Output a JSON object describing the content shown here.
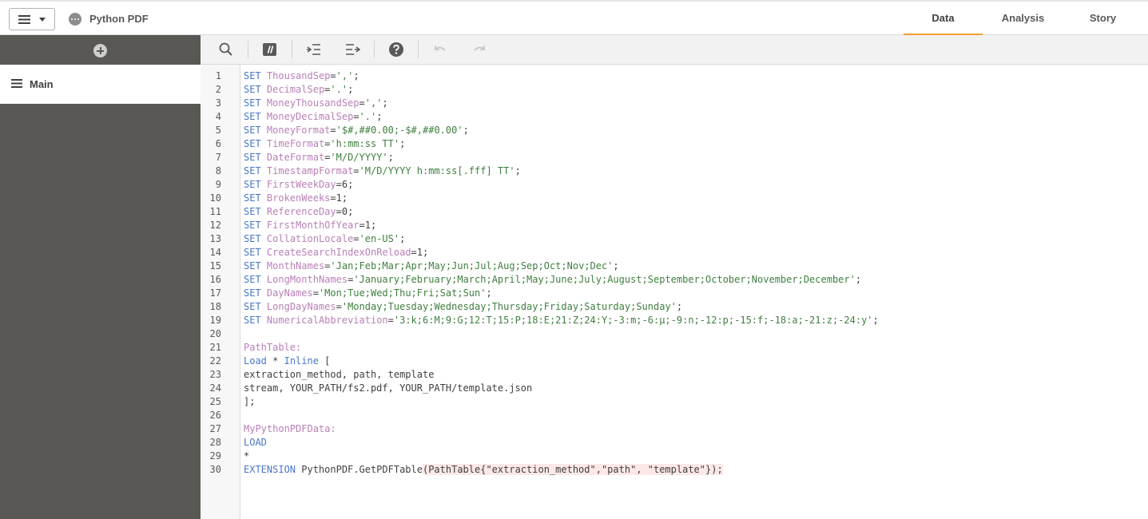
{
  "header": {
    "app_title": "Python PDF",
    "tabs": [
      {
        "label": "Data",
        "active": true
      },
      {
        "label": "Analysis",
        "active": false
      },
      {
        "label": "Story",
        "active": false
      }
    ],
    "accent_color": "#f0a030"
  },
  "sidebar": {
    "add_icon": "plus-circle-icon",
    "sections": [
      {
        "label": "Main",
        "active": true
      }
    ]
  },
  "toolbar": {
    "icons": [
      "search-icon",
      "comment-icon",
      "indent-icon",
      "outdent-icon",
      "help-icon",
      "undo-icon",
      "redo-icon"
    ]
  },
  "editor": {
    "lines": [
      {
        "n": "1",
        "tokens": [
          [
            "k",
            "SET"
          ],
          [
            "p",
            " "
          ],
          [
            "v",
            "ThousandSep"
          ],
          [
            "p",
            "="
          ],
          [
            "s",
            "','"
          ],
          [
            "p",
            ";"
          ]
        ]
      },
      {
        "n": "2",
        "tokens": [
          [
            "k",
            "SET"
          ],
          [
            "p",
            " "
          ],
          [
            "v",
            "DecimalSep"
          ],
          [
            "p",
            "="
          ],
          [
            "s",
            "'.'"
          ],
          [
            "p",
            ";"
          ]
        ]
      },
      {
        "n": "3",
        "tokens": [
          [
            "k",
            "SET"
          ],
          [
            "p",
            " "
          ],
          [
            "v",
            "MoneyThousandSep"
          ],
          [
            "p",
            "="
          ],
          [
            "s",
            "','"
          ],
          [
            "p",
            ";"
          ]
        ]
      },
      {
        "n": "4",
        "tokens": [
          [
            "k",
            "SET"
          ],
          [
            "p",
            " "
          ],
          [
            "v",
            "MoneyDecimalSep"
          ],
          [
            "p",
            "="
          ],
          [
            "s",
            "'.'"
          ],
          [
            "p",
            ";"
          ]
        ]
      },
      {
        "n": "5",
        "tokens": [
          [
            "k",
            "SET"
          ],
          [
            "p",
            " "
          ],
          [
            "v",
            "MoneyFormat"
          ],
          [
            "p",
            "="
          ],
          [
            "s",
            "'$#,##0.00;-$#,##0.00'"
          ],
          [
            "p",
            ";"
          ]
        ]
      },
      {
        "n": "6",
        "tokens": [
          [
            "k",
            "SET"
          ],
          [
            "p",
            " "
          ],
          [
            "v",
            "TimeFormat"
          ],
          [
            "p",
            "="
          ],
          [
            "s",
            "'h:mm:ss TT'"
          ],
          [
            "p",
            ";"
          ]
        ]
      },
      {
        "n": "7",
        "tokens": [
          [
            "k",
            "SET"
          ],
          [
            "p",
            " "
          ],
          [
            "v",
            "DateFormat"
          ],
          [
            "p",
            "="
          ],
          [
            "s",
            "'M/D/YYYY'"
          ],
          [
            "p",
            ";"
          ]
        ]
      },
      {
        "n": "8",
        "tokens": [
          [
            "k",
            "SET"
          ],
          [
            "p",
            " "
          ],
          [
            "v",
            "TimestampFormat"
          ],
          [
            "p",
            "="
          ],
          [
            "s",
            "'M/D/YYYY h:mm:ss[.fff] TT'"
          ],
          [
            "p",
            ";"
          ]
        ]
      },
      {
        "n": "9",
        "tokens": [
          [
            "k",
            "SET"
          ],
          [
            "p",
            " "
          ],
          [
            "v",
            "FirstWeekDay"
          ],
          [
            "p",
            "=6;"
          ]
        ]
      },
      {
        "n": "10",
        "tokens": [
          [
            "k",
            "SET"
          ],
          [
            "p",
            " "
          ],
          [
            "v",
            "BrokenWeeks"
          ],
          [
            "p",
            "=1;"
          ]
        ]
      },
      {
        "n": "11",
        "tokens": [
          [
            "k",
            "SET"
          ],
          [
            "p",
            " "
          ],
          [
            "v",
            "ReferenceDay"
          ],
          [
            "p",
            "=0;"
          ]
        ]
      },
      {
        "n": "12",
        "tokens": [
          [
            "k",
            "SET"
          ],
          [
            "p",
            " "
          ],
          [
            "v",
            "FirstMonthOfYear"
          ],
          [
            "p",
            "=1;"
          ]
        ]
      },
      {
        "n": "13",
        "tokens": [
          [
            "k",
            "SET"
          ],
          [
            "p",
            " "
          ],
          [
            "v",
            "CollationLocale"
          ],
          [
            "p",
            "="
          ],
          [
            "s",
            "'en-US'"
          ],
          [
            "p",
            ";"
          ]
        ]
      },
      {
        "n": "14",
        "tokens": [
          [
            "k",
            "SET"
          ],
          [
            "p",
            " "
          ],
          [
            "v",
            "CreateSearchIndexOnReload"
          ],
          [
            "p",
            "=1;"
          ]
        ]
      },
      {
        "n": "15",
        "tokens": [
          [
            "k",
            "SET"
          ],
          [
            "p",
            " "
          ],
          [
            "v",
            "MonthNames"
          ],
          [
            "p",
            "="
          ],
          [
            "s",
            "'Jan;Feb;Mar;Apr;May;Jun;Jul;Aug;Sep;Oct;Nov;Dec'"
          ],
          [
            "p",
            ";"
          ]
        ]
      },
      {
        "n": "16",
        "tokens": [
          [
            "k",
            "SET"
          ],
          [
            "p",
            " "
          ],
          [
            "v",
            "LongMonthNames"
          ],
          [
            "p",
            "="
          ],
          [
            "s",
            "'January;February;March;April;May;June;July;August;September;October;November;December'"
          ],
          [
            "p",
            ";"
          ]
        ]
      },
      {
        "n": "17",
        "tokens": [
          [
            "k",
            "SET"
          ],
          [
            "p",
            " "
          ],
          [
            "v",
            "DayNames"
          ],
          [
            "p",
            "="
          ],
          [
            "s",
            "'Mon;Tue;Wed;Thu;Fri;Sat;Sun'"
          ],
          [
            "p",
            ";"
          ]
        ]
      },
      {
        "n": "18",
        "tokens": [
          [
            "k",
            "SET"
          ],
          [
            "p",
            " "
          ],
          [
            "v",
            "LongDayNames"
          ],
          [
            "p",
            "="
          ],
          [
            "s",
            "'Monday;Tuesday;Wednesday;Thursday;Friday;Saturday;Sunday'"
          ],
          [
            "p",
            ";"
          ]
        ]
      },
      {
        "n": "19",
        "tokens": [
          [
            "k",
            "SET"
          ],
          [
            "p",
            " "
          ],
          [
            "v",
            "NumericalAbbreviation"
          ],
          [
            "p",
            "="
          ],
          [
            "s",
            "'3:k;6:M;9:G;12:T;15:P;18:E;21:Z;24:Y;-3:m;-6:μ;-9:n;-12:p;-15:f;-18:a;-21:z;-24:y'"
          ],
          [
            "p",
            ";"
          ]
        ]
      },
      {
        "n": "20",
        "tokens": []
      },
      {
        "n": "21",
        "tokens": [
          [
            "v2",
            "PathTable:"
          ]
        ]
      },
      {
        "n": "22",
        "tokens": [
          [
            "k",
            "Load"
          ],
          [
            "p",
            " * "
          ],
          [
            "k",
            "Inline"
          ],
          [
            "p",
            " ["
          ]
        ]
      },
      {
        "n": "23",
        "tokens": [
          [
            "p",
            "extraction_method, path, template"
          ]
        ]
      },
      {
        "n": "24",
        "tokens": [
          [
            "p",
            "stream, YOUR_PATH/fs2.pdf, YOUR_PATH/template.json"
          ]
        ]
      },
      {
        "n": "25",
        "tokens": [
          [
            "p",
            "];"
          ]
        ]
      },
      {
        "n": "26",
        "tokens": []
      },
      {
        "n": "27",
        "tokens": [
          [
            "v2",
            "MyPythonPDFData:"
          ]
        ]
      },
      {
        "n": "28",
        "tokens": [
          [
            "k",
            "LOAD"
          ]
        ]
      },
      {
        "n": "29",
        "tokens": [
          [
            "p",
            "*"
          ]
        ]
      },
      {
        "n": "30",
        "tokens": [
          [
            "k",
            "EXTENSION"
          ],
          [
            "p",
            " PythonPDF.GetPDFTable"
          ],
          [
            "e",
            "(PathTable{\"extraction_method\",\"path\", \"template\"});"
          ]
        ]
      }
    ],
    "colors": {
      "keyword": "#4a76c6",
      "variable": "#b97fb7",
      "string": "#3f7f3f",
      "error_bg": "#fde8e8"
    }
  }
}
